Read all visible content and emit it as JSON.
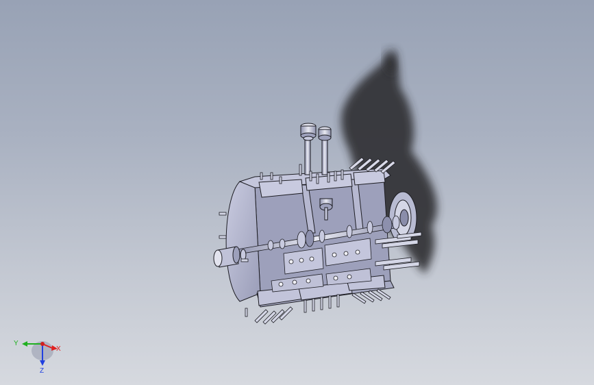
{
  "viewport": {
    "background_top": "#98a2b5",
    "background_bottom": "#d6d9df"
  },
  "model": {
    "body_color": "#b4b7cf",
    "shadow_color": "#2e2f33",
    "edge_color": "#1c1c22"
  },
  "triad": {
    "x_label": "X",
    "y_label": "Y",
    "z_label": "Z",
    "x_color": "#e02020",
    "y_color": "#20b020",
    "z_color": "#2040e0"
  }
}
